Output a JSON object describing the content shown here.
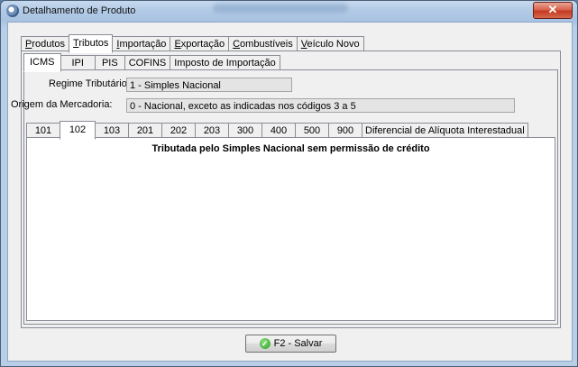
{
  "window": {
    "title": "Detalhamento de Produto",
    "close_glyph": "✕"
  },
  "main_tabs": [
    {
      "label": "Produtos",
      "underline": "P",
      "rest": "rodutos",
      "active": false
    },
    {
      "label": "Tributos",
      "underline": "T",
      "rest": "ributos",
      "active": true
    },
    {
      "label": "Importação",
      "underline": "I",
      "rest": "mportação",
      "active": false
    },
    {
      "label": "Exportação",
      "underline": "E",
      "rest": "xportação",
      "active": false
    },
    {
      "label": "Combustíveis",
      "underline": "C",
      "rest": "ombustíveis",
      "active": false
    },
    {
      "label": "Veículo Novo",
      "underline": "V",
      "rest": "eículo Novo",
      "active": false
    }
  ],
  "tax_tabs": [
    "ICMS",
    "IPI",
    "PIS",
    "COFINS",
    "Imposto de Importação"
  ],
  "tax_tab_active": "ICMS",
  "fields": {
    "regime_label": "Regime Tributário:",
    "regime_value": "1 - Simples Nacional",
    "origem_label": "Origem da Mercadoria:",
    "origem_value": "0 - Nacional, exceto as indicadas nos códigos 3 a 5"
  },
  "cst_tabs": [
    "101",
    "102",
    "103",
    "201",
    "202",
    "203",
    "300",
    "400",
    "500",
    "900",
    "Diferencial de Alíquota Interestadual"
  ],
  "cst_tab_active": "102",
  "content": {
    "description": "Tributada pelo Simples Nacional sem permissão de crédito"
  },
  "footer": {
    "save_label": "F2 - Salvar",
    "save_icon": "check-circle-icon"
  }
}
